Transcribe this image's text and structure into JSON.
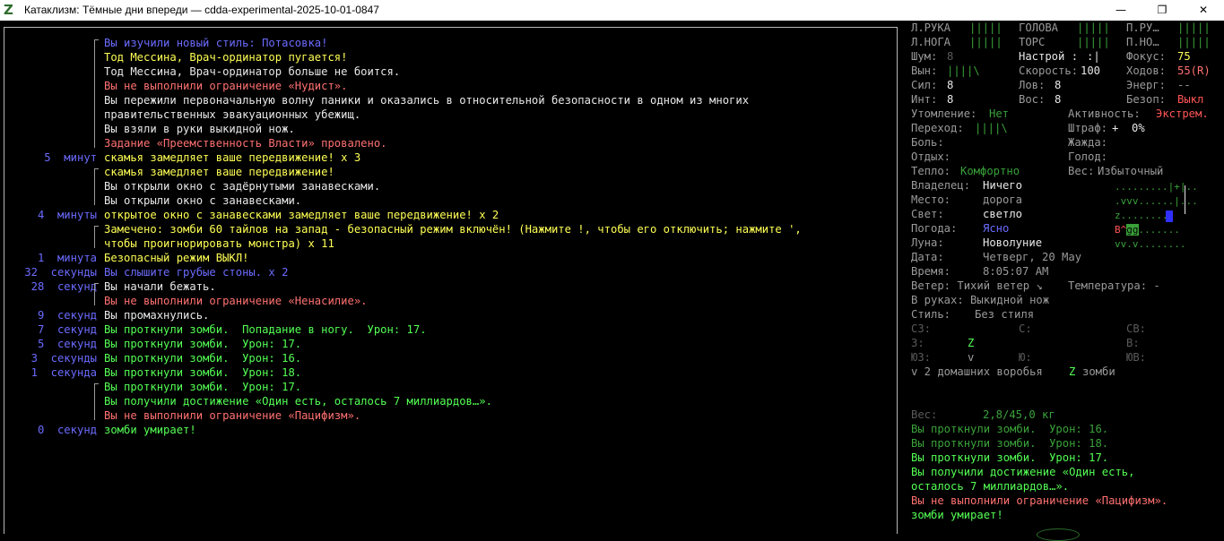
{
  "window": {
    "title": "Катаклизм: Тёмные дни впереди — cdda-experimental-2025-10-01-0847",
    "icon": "z-logo-icon",
    "minimize": "—",
    "maximize": "❐",
    "close": "✕"
  },
  "log": [
    {
      "ts_num": "",
      "ts_unit": "",
      "text": "Вы изучили новый стиль: Потасовка!",
      "color": "#6b6bff"
    },
    {
      "ts_num": "",
      "ts_unit": "",
      "text": "Тод Мессина, Врач-ординатор пугается!",
      "color": "#ffff55"
    },
    {
      "ts_num": "",
      "ts_unit": "",
      "text": "Тод Мессина, Врач-ординатор больше не боится.",
      "color": "#e8e8e8"
    },
    {
      "ts_num": "",
      "ts_unit": "",
      "text": "Вы не выполнили ограничение «Нудист».",
      "color": "#ff7070"
    },
    {
      "ts_num": "",
      "ts_unit": "",
      "text": "Вы пережили первоначальную волну паники и оказались в относительной безопасности в одном из многих",
      "color": "#e8e8e8"
    },
    {
      "ts_num": "",
      "ts_unit": "",
      "text": "правительственных эвакуационных убежищ.",
      "color": "#e8e8e8"
    },
    {
      "ts_num": "",
      "ts_unit": "",
      "text": "Вы взяли в руки выкидной нож.",
      "color": "#e8e8e8"
    },
    {
      "ts_num": "",
      "ts_unit": "",
      "text": "Задание «Преемственность Власти» провалено.",
      "color": "#ff7070"
    },
    {
      "ts_num": "5",
      "ts_unit": "минут",
      "text": "скамья замедляет ваше передвижение! x 3",
      "color": "#ffff55"
    },
    {
      "ts_num": "",
      "ts_unit": "",
      "text": "скамья замедляет ваше передвижение!",
      "color": "#ffff55"
    },
    {
      "ts_num": "",
      "ts_unit": "",
      "text": "Вы открыли окно с задёрнутыми занавесками.",
      "color": "#e8e8e8"
    },
    {
      "ts_num": "",
      "ts_unit": "",
      "text": "Вы открыли окно с занавесками.",
      "color": "#e8e8e8"
    },
    {
      "ts_num": "4",
      "ts_unit": "минуты",
      "text": "открытое окно с занавесками замедляет ваше передвижение! x 2",
      "color": "#ffff55"
    },
    {
      "ts_num": "",
      "ts_unit": "",
      "text": "Замечено: зомби 60 тайлов на запад - безопасный режим включён! (Нажмите !, чтобы его отключить; нажмите ',",
      "color": "#ffff55"
    },
    {
      "ts_num": "",
      "ts_unit": "",
      "text": "чтобы проигнорировать монстра) x 11",
      "color": "#ffff55"
    },
    {
      "ts_num": "1",
      "ts_unit": "минута",
      "text": "Безопасный режим ВЫКЛ!",
      "color": "#ffff55"
    },
    {
      "ts_num": "32",
      "ts_unit": "секунды",
      "text": "Вы слышите грубые стоны. x 2",
      "color": "#6b6bff"
    },
    {
      "ts_num": "28",
      "ts_unit": "секунд",
      "text": "Вы начали бежать.",
      "color": "#e8e8e8"
    },
    {
      "ts_num": "",
      "ts_unit": "",
      "text": "Вы не выполнили ограничение «Ненасилие».",
      "color": "#ff7070"
    },
    {
      "ts_num": "9",
      "ts_unit": "секунд",
      "text": "Вы промахнулись.",
      "color": "#e8e8e8"
    },
    {
      "ts_num": "7",
      "ts_unit": "секунд",
      "text": "Вы проткнули зомби.  Попадание в ногу.  Урон: 17.",
      "color": "#54ff54"
    },
    {
      "ts_num": "5",
      "ts_unit": "секунд",
      "text": "Вы проткнули зомби.  Урон: 17.",
      "color": "#54ff54"
    },
    {
      "ts_num": "3",
      "ts_unit": "секунды",
      "text": "Вы проткнули зомби.  Урон: 16.",
      "color": "#54ff54"
    },
    {
      "ts_num": "1",
      "ts_unit": "секунда",
      "text": "Вы проткнули зомби.  Урон: 18.",
      "color": "#54ff54"
    },
    {
      "ts_num": "",
      "ts_unit": "",
      "text": "Вы проткнули зомби.  Урон: 17.",
      "color": "#54ff54"
    },
    {
      "ts_num": "",
      "ts_unit": "",
      "text": "Вы получили достижение «Один есть, осталось 7 миллиардов…».",
      "color": "#54ff54"
    },
    {
      "ts_num": "",
      "ts_unit": "",
      "text": "Вы не выполнили ограничение «Пацифизм».",
      "color": "#ff7070"
    },
    {
      "ts_num": "0",
      "ts_unit": "секунд",
      "text": "зомби умирает!",
      "color": "#54ff54"
    }
  ],
  "sidebar": {
    "limbs": {
      "l_arm": "Л.РУКА",
      "l_arm_bar": "|||||",
      "head": "ГОЛОВА",
      "head_bar": "|||||",
      "r_arm": "П.РУ…",
      "r_arm_bar": "|||||",
      "l_leg": "Л.НОГА",
      "l_leg_bar": "|||||",
      "torso": "ТОРС",
      "torso_bar": "|||||",
      "r_leg": "П.НО…",
      "r_leg_bar": "|||||"
    },
    "stats": {
      "noise_label": "Шум:",
      "noise": "8",
      "mood_label": "Настрой :",
      "mood": ":|",
      "focus_label": "Фокус:",
      "focus": "75",
      "stamina_label": "Вын:",
      "stamina_bar": "||||\\",
      "speed_label": "Скорость:",
      "speed": "100",
      "moves_label": "Ходов:",
      "moves": "55(R)",
      "str_label": "Сил:",
      "str": "8",
      "dex_label": "Лов:",
      "dex": "8",
      "energy_label": "Энерг:",
      "energy": "--",
      "int_label": "Инт:",
      "int": "8",
      "per_label": "Вос:",
      "per": "8",
      "safe_label": "Безоп:",
      "safe": "Выкл",
      "fatigue_label": "Утомление:",
      "fatigue": "Нет",
      "activity_label": "Активность:",
      "activity": "Экстрем.",
      "transition_label": "Переход:",
      "transition": "||||\\",
      "penalty_label": "Штраф:",
      "penalty": "+  0%",
      "pain_label": "Боль:",
      "thirst_label": "Жажда:",
      "rest_label": "Отдых:",
      "hunger_label": "Голод:",
      "heat_label": "Тепло:",
      "heat": "Комфортно",
      "weight_label": "Вес:",
      "weight": "Избыточный"
    },
    "env": {
      "owner_label": "Владелец:",
      "owner": "Ничего",
      "place_label": "Место:",
      "place": "дорога",
      "light_label": "Свет:",
      "light": "светло",
      "weather_label": "Погода:",
      "weather": "Ясно",
      "moon_label": "Луна:",
      "moon": "Новолуние",
      "date_label": "Дата:",
      "date": "Четверг, 20 May",
      "time_label": "Время:",
      "time": "8:05:07 AM",
      "wind": "Ветер: Тихий ветер ↘",
      "temp": "Температура: -",
      "hands": "В руках: Выкидной нож",
      "style_label": "Стиль:",
      "style": "Без стиля"
    },
    "minimap": {
      "row1": ".........|+|..",
      "row2": ".vvv......|...",
      "row3": "z.........",
      "row4_red": "B^",
      "row4_hl": "gg",
      "row4_rest": ".......",
      "row5": "vv.v........"
    },
    "compass": {
      "nw": "СЗ:",
      "n": "С:",
      "ne": "СВ:",
      "w": "З:",
      "w_mark": "Z",
      "e": "В:",
      "sw": "ЮЗ:",
      "sw_mark": "v",
      "s": "Ю:",
      "se": "ЮВ:"
    },
    "visible": "v 2 домашних воробья",
    "visible_z": "Z",
    "visible_z_text": "зомби",
    "carry_label": "Вес:",
    "carry": "2,8/45,0 кг",
    "mini_log": [
      {
        "text": "Вы проткнули зомби.  Урон: 16.",
        "color": "#3aa13a"
      },
      {
        "text": "Вы проткнули зомби.  Урон: 18.",
        "color": "#3aa13a"
      },
      {
        "text": "Вы проткнули зомби.  Урон: 17.",
        "color": "#54ff54"
      },
      {
        "text": "Вы получили достижение «Один есть,",
        "color": "#54ff54"
      },
      {
        "text": "осталось 7 миллиардов…».",
        "color": "#54ff54"
      },
      {
        "text": "Вы не выполнили ограничение «Пацифизм».",
        "color": "#ff7070"
      },
      {
        "text": "зомби умирает!",
        "color": "#54ff54"
      }
    ]
  },
  "colors": {
    "bg": "#000000",
    "white": "#e8e8e8",
    "yellow": "#ffff55",
    "red": "#ff5555",
    "green": "#54ff54",
    "dark_green": "#3aa13a",
    "blue": "#6b6bff",
    "gray": "#9a9a9a"
  }
}
